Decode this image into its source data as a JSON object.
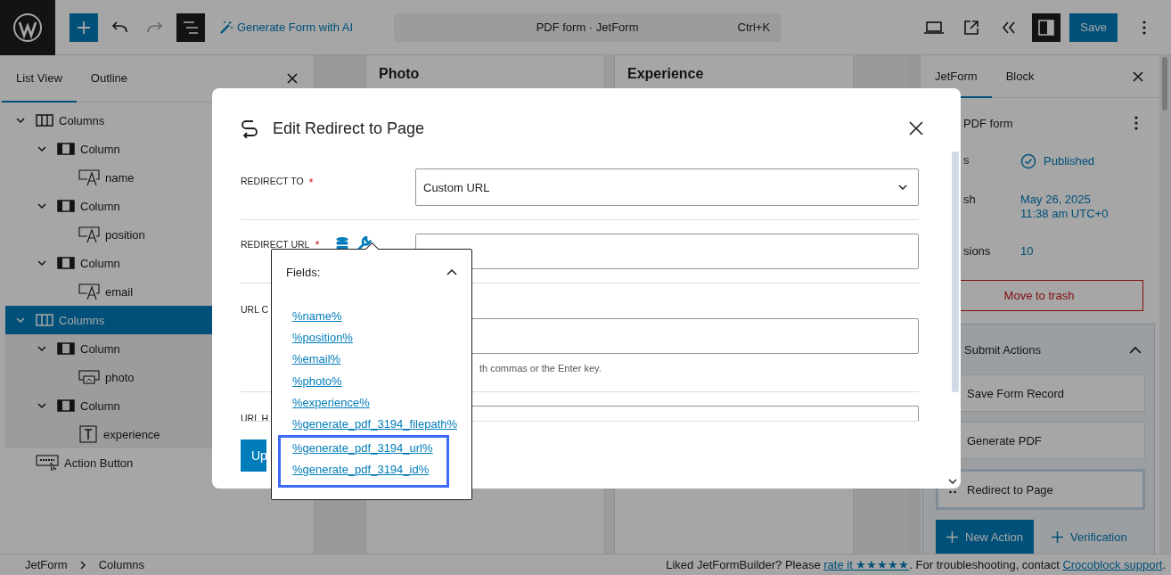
{
  "topbar": {
    "tools": [
      {
        "kind": "add",
        "pressed": false,
        "disabled": false
      },
      {
        "kind": "undo",
        "pressed": false,
        "disabled": false
      },
      {
        "kind": "redo",
        "pressed": false,
        "disabled": true
      },
      {
        "kind": "list-view",
        "pressed": true,
        "disabled": false
      }
    ],
    "ai_link": "Generate Form with AI",
    "command": {
      "title": "PDF form · JetForm",
      "shortcut": "Ctrl+K"
    },
    "right_tools": [
      {
        "kind": "preview",
        "pressed": false
      },
      {
        "kind": "external",
        "pressed": false
      },
      {
        "kind": "collapse",
        "pressed": false
      },
      {
        "kind": "sidebar",
        "pressed": true
      }
    ],
    "save": "Save"
  },
  "left_panel": {
    "tabs": [
      {
        "label": "List View",
        "selected": true
      },
      {
        "label": "Outline",
        "selected": false
      }
    ],
    "tree": [
      {
        "label": "Columns",
        "kind": "columns",
        "expanded": true,
        "selected": false,
        "children": [
          {
            "label": "Column",
            "kind": "column",
            "expanded": true,
            "selected": false,
            "children": [
              {
                "label": "name",
                "kind": "text-field",
                "selected": false
              }
            ]
          },
          {
            "label": "Column",
            "kind": "column",
            "expanded": true,
            "selected": false,
            "children": [
              {
                "label": "position",
                "kind": "text-field",
                "selected": false
              }
            ]
          },
          {
            "label": "Column",
            "kind": "column",
            "expanded": true,
            "selected": false,
            "children": [
              {
                "label": "email",
                "kind": "text-field",
                "selected": false
              }
            ]
          }
        ]
      },
      {
        "label": "Columns",
        "kind": "columns",
        "expanded": true,
        "selected": true,
        "children": [
          {
            "label": "Column",
            "kind": "column",
            "expanded": true,
            "selected": false,
            "children": [
              {
                "label": "photo",
                "kind": "media-field",
                "selected": false
              }
            ]
          },
          {
            "label": "Column",
            "kind": "column",
            "expanded": true,
            "selected": false,
            "children": [
              {
                "label": "experience",
                "kind": "textarea",
                "selected": false
              }
            ]
          }
        ]
      },
      {
        "label": "Action Button",
        "kind": "action-button",
        "selected": false
      }
    ]
  },
  "canvas": {
    "columns": [
      {
        "heading": "Photo"
      },
      {
        "heading": "Experience"
      }
    ]
  },
  "right_panel": {
    "tabs": [
      {
        "label": "JetForm",
        "selected": true
      },
      {
        "label": "Block",
        "selected": false
      }
    ],
    "form_title": "PDF form",
    "rows": [
      {
        "label": "s",
        "kind": "status",
        "lines": [
          "Published"
        ]
      },
      {
        "label": "sh",
        "kind": "date",
        "lines": [
          "May 26, 2025",
          "11:38 am UTC+0"
        ]
      },
      {
        "label": "sions",
        "kind": "count",
        "lines": [
          "10"
        ]
      }
    ],
    "trash": "Move to trash",
    "actions": {
      "title": "Submit Actions",
      "expanded": true,
      "items": [
        {
          "label": "Save Form Record",
          "selected": false
        },
        {
          "label": "Generate PDF",
          "selected": false
        },
        {
          "label": "Redirect to Page",
          "selected": true
        }
      ],
      "new_action": "New Action",
      "verification": "Verification"
    }
  },
  "modal": {
    "title": "Edit Redirect to Page",
    "rows": [
      {
        "kind": "select",
        "label": "REDIRECT TO",
        "required_mark": "*",
        "value": "Custom URL"
      },
      {
        "kind": "macro-input",
        "label": "REDIRECT URL",
        "required_mark": "*"
      },
      {
        "kind": "tags",
        "label": "URL C",
        "help": "th commas or the Enter key."
      },
      {
        "kind": "input",
        "label": "URL H"
      }
    ],
    "submit": "Up"
  },
  "popover": {
    "title": "Fields:",
    "expanded": true,
    "items": [
      {
        "label": "%name%",
        "highlighted": false
      },
      {
        "label": "%position%",
        "highlighted": false
      },
      {
        "label": "%email%",
        "highlighted": false
      },
      {
        "label": "%photo%",
        "highlighted": false
      },
      {
        "label": "%experience%",
        "highlighted": false
      },
      {
        "label": "%generate_pdf_3194_filepath%",
        "highlighted": false
      },
      {
        "label": "%generate_pdf_3194_url%",
        "highlighted": true
      },
      {
        "label": "%generate_pdf_3194_id%",
        "highlighted": true
      }
    ]
  },
  "footer": {
    "breadcrumb": [
      {
        "label": "JetForm"
      },
      {
        "label": "Columns"
      }
    ],
    "note": {
      "before": "Liked JetFormBuilder? Please ",
      "rate_link": "rate it ★★★★★",
      "middle": ". For troubleshooting, contact ",
      "support_link": "Crocoblock support",
      "after": "."
    }
  }
}
